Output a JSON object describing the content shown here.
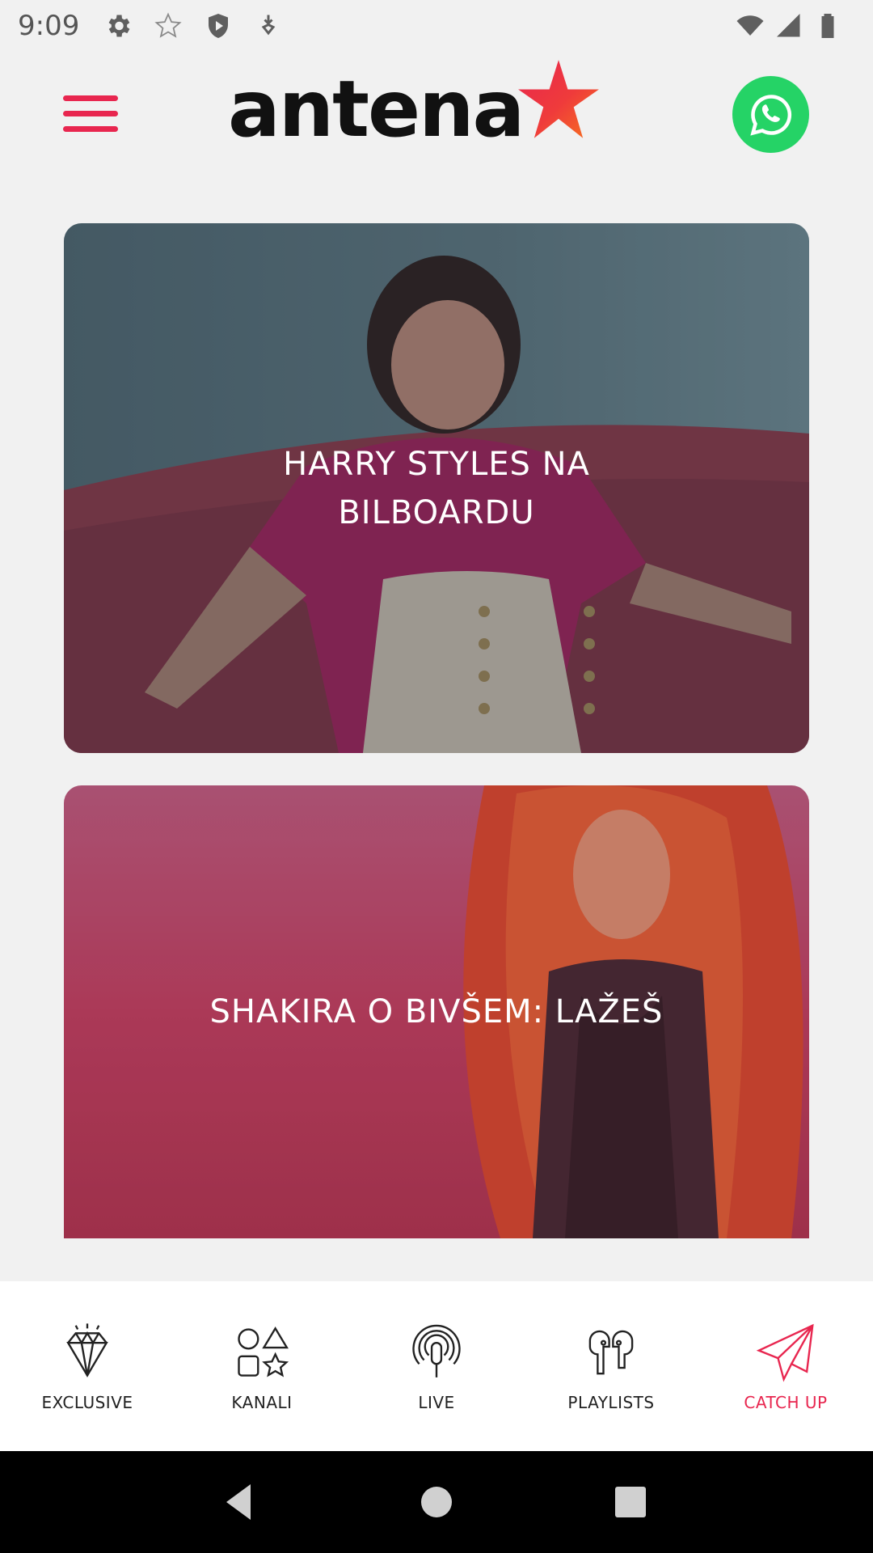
{
  "status_bar": {
    "time": "9:09",
    "icons": [
      "gear-icon",
      "star-outline-icon",
      "shield-play-icon",
      "download-icon",
      "wifi-icon",
      "cellular-signal-icon",
      "battery-icon"
    ]
  },
  "header": {
    "logo_text": "antena",
    "menu_icon": "hamburger-menu-icon",
    "whatsapp_icon": "whatsapp-icon",
    "accent_color": "#e8264f",
    "whatsapp_color": "#25d366"
  },
  "cards": [
    {
      "title": "HARRY STYLES NA BILBOARDU",
      "image": "harry-styles-photo"
    },
    {
      "title": "SHAKIRA O BIVŠEM: LAŽEŠ",
      "image": "shakira-photo"
    }
  ],
  "bottom_nav": {
    "items": [
      {
        "label": "EXCLUSIVE",
        "icon": "diamond-icon",
        "active": false
      },
      {
        "label": "KANALI",
        "icon": "shapes-icon",
        "active": false
      },
      {
        "label": "LIVE",
        "icon": "live-broadcast-icon",
        "active": false
      },
      {
        "label": "PLAYLISTS",
        "icon": "earbuds-icon",
        "active": false
      },
      {
        "label": "CATCH UP",
        "icon": "paper-plane-icon",
        "active": true
      }
    ]
  },
  "system_nav": {
    "icons": [
      "back-icon",
      "home-icon",
      "recents-icon"
    ]
  }
}
